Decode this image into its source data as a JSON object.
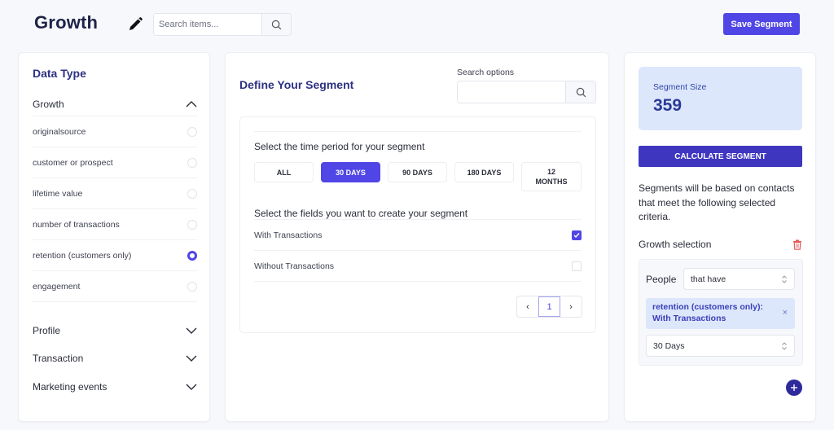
{
  "header": {
    "title": "Growth",
    "edit_icon": "pencil-icon",
    "search_placeholder": "Search items...",
    "search_value": "",
    "search_icon": "search-icon",
    "save_label": "Save Segment",
    "accent_color": "#4f46e5"
  },
  "sidebar": {
    "title": "Data Type",
    "open_section": {
      "label": "Growth",
      "icon": "chevron-up-icon",
      "options": [
        {
          "label": "originalsource",
          "selected": false
        },
        {
          "label": "customer or prospect",
          "selected": false
        },
        {
          "label": "lifetime value",
          "selected": false
        },
        {
          "label": "number of transactions",
          "selected": false
        },
        {
          "label": "retention (customers only)",
          "selected": true
        },
        {
          "label": "engagement",
          "selected": false
        }
      ]
    },
    "closed_sections": [
      {
        "label": "Profile",
        "icon": "chevron-down-icon"
      },
      {
        "label": "Transaction",
        "icon": "chevron-down-icon"
      },
      {
        "label": "Marketing events",
        "icon": "chevron-down-icon"
      }
    ]
  },
  "main": {
    "title": "Define Your Segment",
    "search_options_label": "Search options",
    "search_options_value": "",
    "time_period_label": "Select the time period for your segment",
    "periods": [
      {
        "label": "ALL",
        "active": false
      },
      {
        "label": "30 DAYS",
        "active": true
      },
      {
        "label": "90 DAYS",
        "active": false
      },
      {
        "label": "180 DAYS",
        "active": false
      },
      {
        "label": "12 MONTHS",
        "active": false
      }
    ],
    "fields_label": "Select the fields you want to create your segment",
    "fields": [
      {
        "label": "With Transactions",
        "checked": true
      },
      {
        "label": "Without Transactions",
        "checked": false
      }
    ],
    "pagination": {
      "prev": "‹",
      "current": "1",
      "next": "›"
    }
  },
  "summary": {
    "size_label": "Segment Size",
    "size_value": "359",
    "calculate_label": "CALCULATE SEGMENT",
    "description": "Segments will be based on contacts that meet the following selected criteria.",
    "selection_label": "Growth selection",
    "delete_icon": "trash-icon",
    "criteria": {
      "subject_label": "People",
      "qualifier": "that have",
      "chip_line1": "retention (customers only):",
      "chip_line2": "With Transactions",
      "chip_remove": "×",
      "period": "30 Days"
    },
    "add_icon": "plus-icon"
  }
}
